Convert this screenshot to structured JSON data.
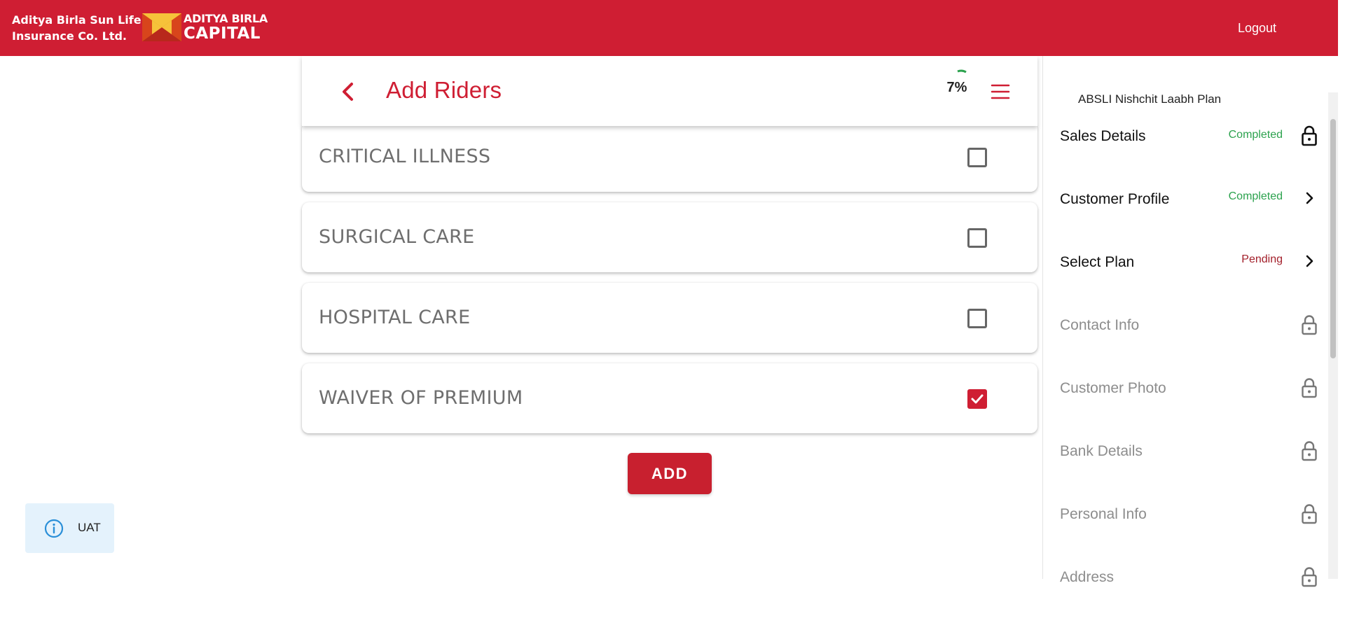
{
  "header": {
    "brand_line1": "Aditya Birla Sun Life",
    "brand_line2": "Insurance Co. Ltd.",
    "logo_line1": "ADITYA BIRLA",
    "logo_line2": "CAPITAL",
    "logout_label": "Logout",
    "brand_color": "#cf1e33"
  },
  "page": {
    "title": "Add Riders",
    "progress": "7%",
    "progress_value": 0.07,
    "back_icon": "chevron-left-icon",
    "menu_icon": "hamburger-menu-icon"
  },
  "riders": [
    {
      "label": "CRITICAL ILLNESS",
      "checked": false
    },
    {
      "label": "SURGICAL CARE",
      "checked": false
    },
    {
      "label": "HOSPITAL CARE",
      "checked": false
    },
    {
      "label": "WAIVER OF PREMIUM",
      "checked": true
    }
  ],
  "add_button": {
    "label": "ADD"
  },
  "env_badge": {
    "label": "UAT",
    "icon": "info-icon"
  },
  "sidebar": {
    "plan_name": "ABSLI Nishchit Laabh Plan",
    "items": [
      {
        "label": "Sales Details",
        "status": "Completed",
        "icon": "lock-open-icon"
      },
      {
        "label": "Customer Profile",
        "status": "Completed",
        "icon": "chevron-right-icon"
      },
      {
        "label": "Select Plan",
        "status": "Pending",
        "icon": "chevron-right-icon"
      },
      {
        "label": "Contact Info",
        "status": "",
        "icon": "lock-icon"
      },
      {
        "label": "Customer Photo",
        "status": "",
        "icon": "lock-icon"
      },
      {
        "label": "Bank Details",
        "status": "",
        "icon": "lock-icon"
      },
      {
        "label": "Personal Info",
        "status": "",
        "icon": "lock-icon"
      },
      {
        "label": "Address",
        "status": "",
        "icon": "lock-icon"
      }
    ]
  }
}
